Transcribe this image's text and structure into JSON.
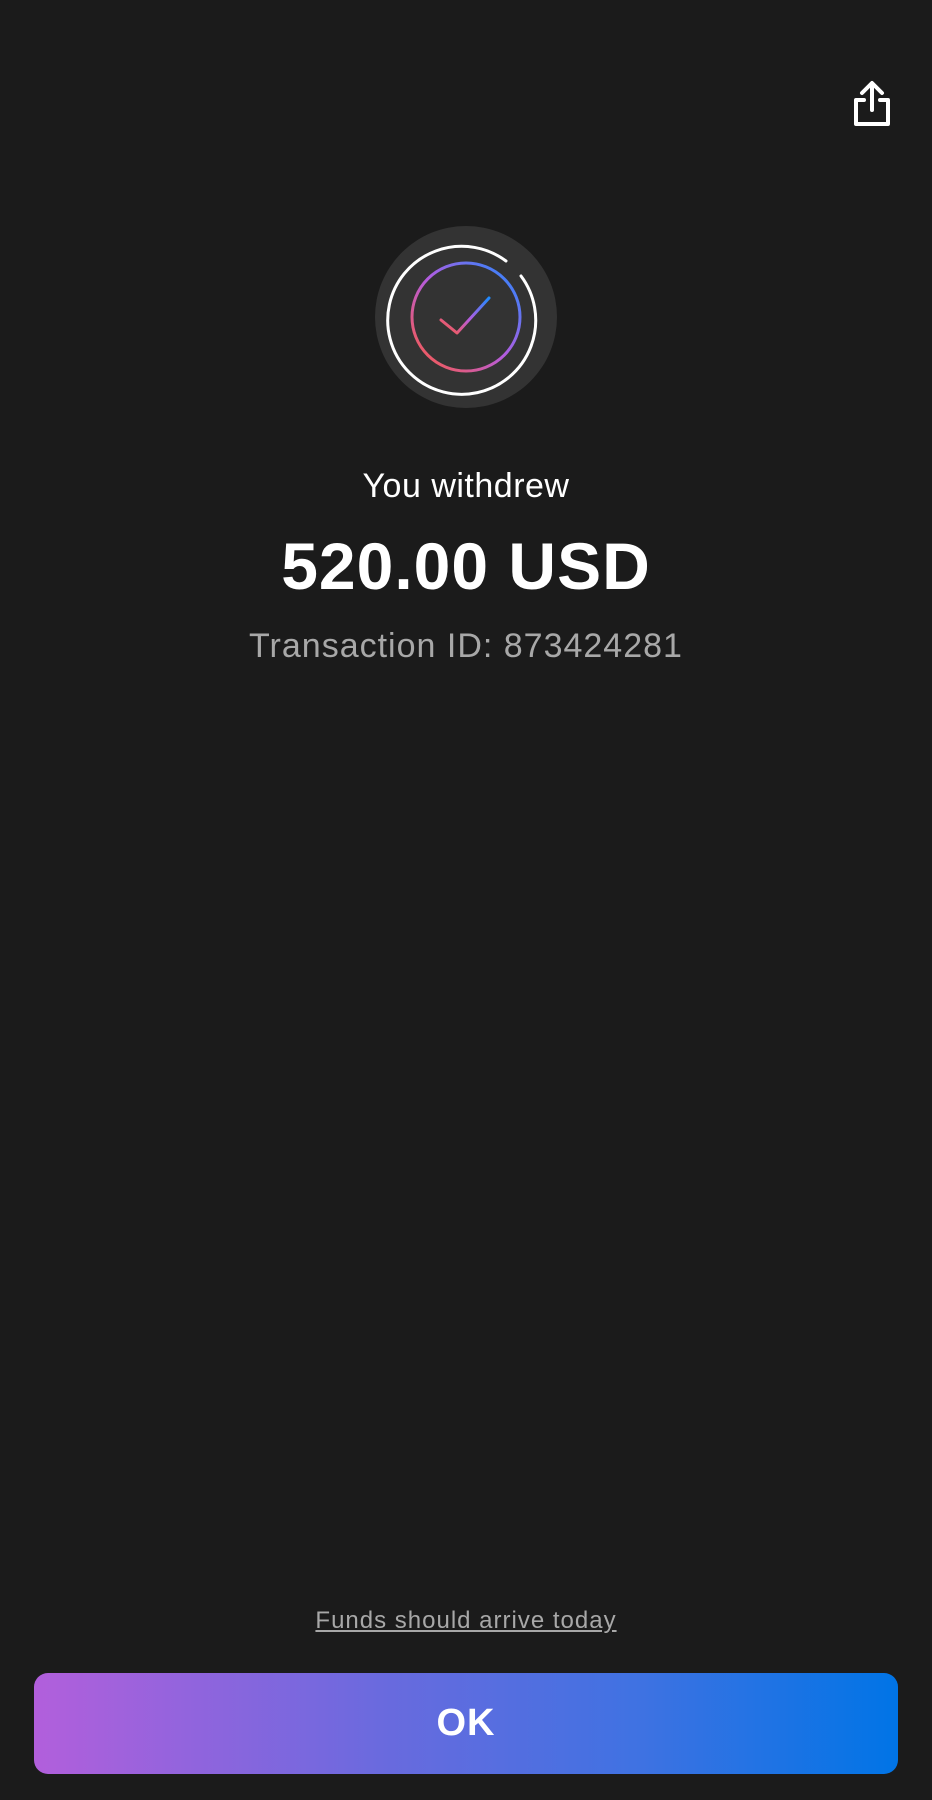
{
  "header": {
    "share_icon": "share-icon"
  },
  "status": {
    "icon": "check-circle-icon",
    "colors": {
      "ring_outer": "#333333",
      "ring_white": "#ffffff",
      "gradient_start": "#ff5a3c",
      "gradient_mid": "#b45ce0",
      "gradient_end": "#1e8bff"
    }
  },
  "transaction": {
    "headline": "You withdrew",
    "amount": "520.00 USD",
    "id_text": "Transaction ID: 873424281"
  },
  "footer": {
    "arrival_text": "Funds should arrive today",
    "ok_label": "OK"
  },
  "theme": {
    "background": "#1b1b1b",
    "secondary_text": "#a8a8a8",
    "button_gradient_start": "#b25fdc",
    "button_gradient_end": "#0074e6"
  }
}
